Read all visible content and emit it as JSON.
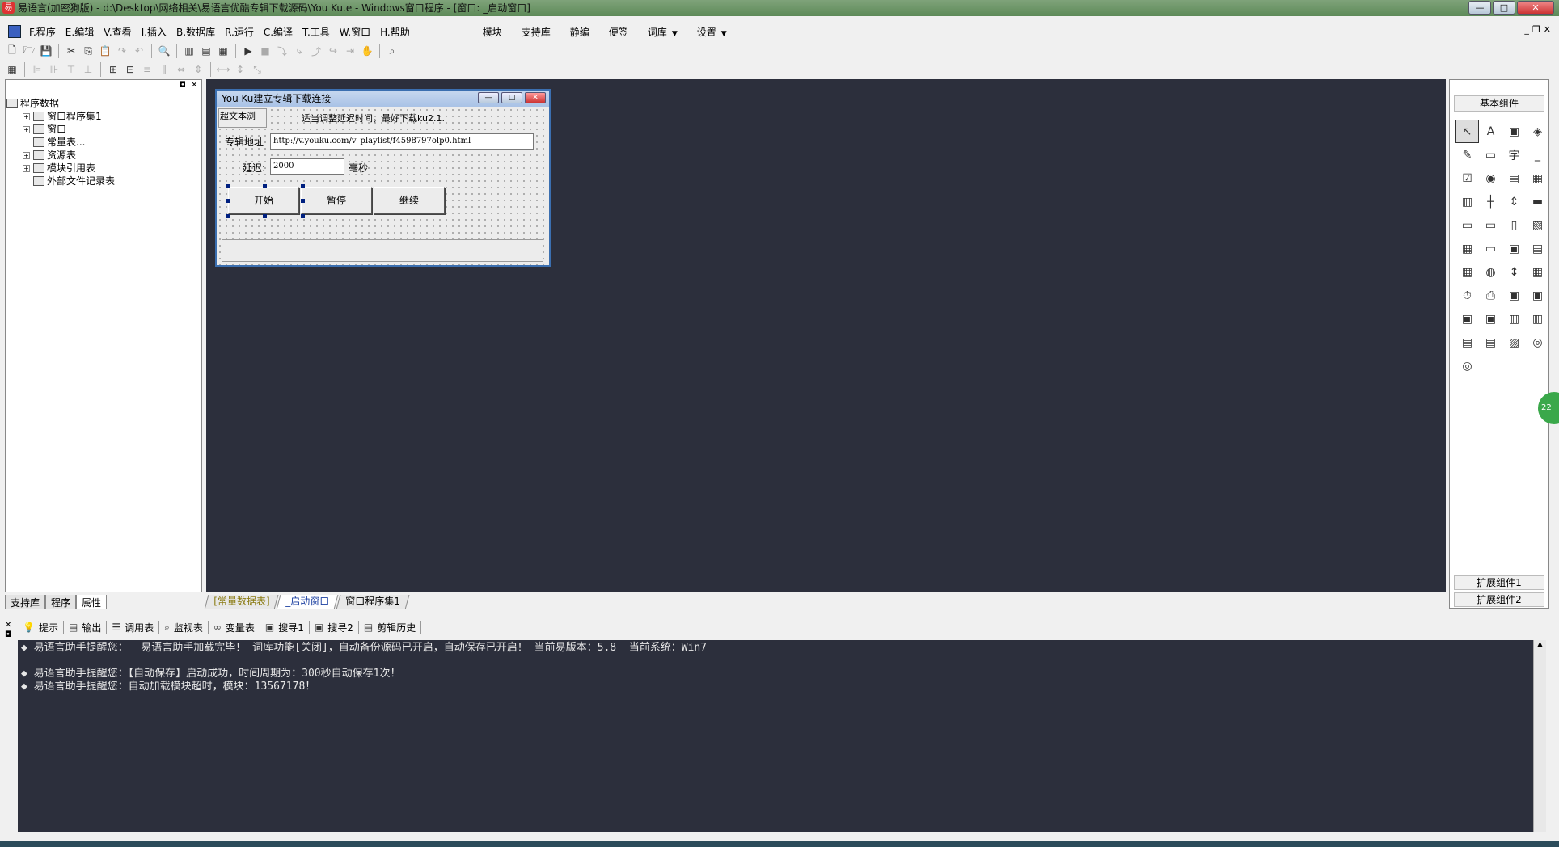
{
  "window": {
    "title": "易语言(加密狗版) - d:\\Desktop\\网络相关\\易语言优酷专辑下载源码\\You Ku.e - Windows窗口程序 - [窗口: _启动窗口]",
    "min": "—",
    "max": "□",
    "close": "✕"
  },
  "menu": {
    "items": [
      "F.程序",
      "E.编辑",
      "V.查看",
      "I.插入",
      "B.数据库",
      "R.运行",
      "C.编译",
      "T.工具",
      "W.窗口",
      "H.帮助"
    ],
    "right_items": [
      "模块",
      "支持库",
      "静编",
      "便签",
      "词库",
      "设置"
    ],
    "dropdown": "▼"
  },
  "left_panel": {
    "tree": [
      {
        "label": "程序数据",
        "expand": "",
        "level": 1
      },
      {
        "label": "窗口程序集1",
        "expand": "+",
        "level": 2
      },
      {
        "label": "窗口",
        "expand": "+",
        "level": 2
      },
      {
        "label": "常量表...",
        "expand": "",
        "level": 2
      },
      {
        "label": "资源表",
        "expand": "+",
        "level": 2
      },
      {
        "label": "模块引用表",
        "expand": "+",
        "level": 2
      },
      {
        "label": "外部文件记录表",
        "expand": "",
        "level": 2
      }
    ],
    "tabs": [
      "支持库",
      "程序",
      "属性"
    ]
  },
  "form": {
    "title": "You Ku建立专辑下载连接",
    "label_hypertext": "超文本浏",
    "hint": "适当调整延迟时间，最好下载ku2.1.",
    "label_url": "专辑地址",
    "url_value": "http://v.youku.com/v_playlist/f4598797olp0.html",
    "label_delay": "延迟:",
    "delay_value": "2000",
    "unit_ms": "毫秒",
    "btn_start": "开始",
    "btn_pause": "暂停",
    "btn_continue": "继续"
  },
  "workspace_tabs": [
    "[常量数据表]",
    "_启动窗口",
    "窗口程序集1"
  ],
  "right_panel": {
    "title": "基本组件",
    "icons": [
      "↖",
      "A",
      "▣",
      "◈",
      "✎",
      "▭",
      "字",
      "_",
      "☑",
      "◉",
      "▤",
      "▦",
      "▥",
      "┼",
      "⇕",
      "▬",
      "▭",
      "▭",
      "▯",
      "▧",
      "▦",
      "▭",
      "▣",
      "▤",
      "▦",
      "◍",
      "↕",
      "▦",
      "⏱",
      "⎙",
      "▣",
      "▣",
      "▣",
      "▣",
      "▥",
      "▥",
      "▤",
      "▤",
      "▨",
      "◎",
      "◎"
    ],
    "ext1": "扩展组件1",
    "ext2": "扩展组件2",
    "badge": "22"
  },
  "output_tabs": [
    "提示",
    "输出",
    "调用表",
    "监视表",
    "变量表",
    "搜寻1",
    "搜寻2",
    "剪辑历史"
  ],
  "output_lines": [
    "◆ 易语言助手提醒您：  易语言助手加载完毕！ 词库功能[关闭]，自动备份源码已开启，自动保存已开启！ 当前易版本：5.8  当前系统：Win7",
    "",
    "◆ 易语言助手提醒您：【自动保存】启动成功，时间周期为：300秒自动保存1次！",
    "◆ 易语言助手提醒您：自动加载模块超时，模块：13567178！"
  ]
}
